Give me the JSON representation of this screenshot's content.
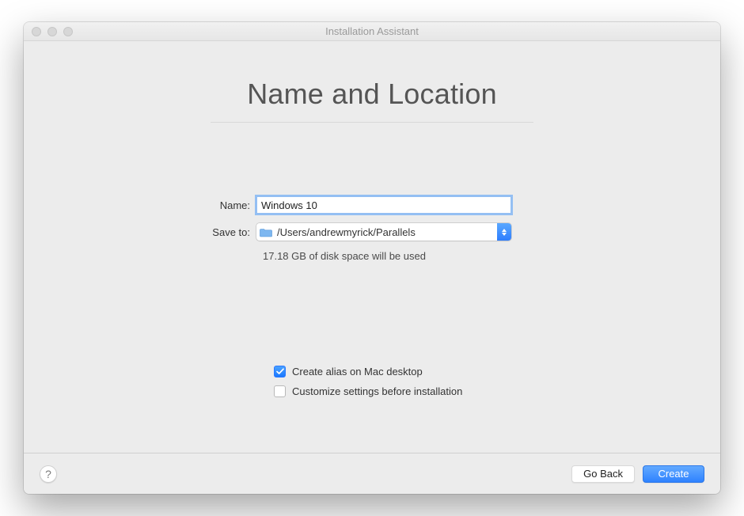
{
  "window": {
    "title": "Installation Assistant"
  },
  "page": {
    "heading": "Name and Location"
  },
  "form": {
    "name_label": "Name:",
    "name_value": "Windows 10",
    "saveto_label": "Save to:",
    "saveto_path": "/Users/andrewmyrick/Parallels",
    "disk_note": "17.18 GB of disk space will be used"
  },
  "options": {
    "alias_label": "Create alias on Mac desktop",
    "alias_checked": true,
    "customize_label": "Customize settings before installation",
    "customize_checked": false
  },
  "footer": {
    "back_label": "Go Back",
    "create_label": "Create"
  }
}
